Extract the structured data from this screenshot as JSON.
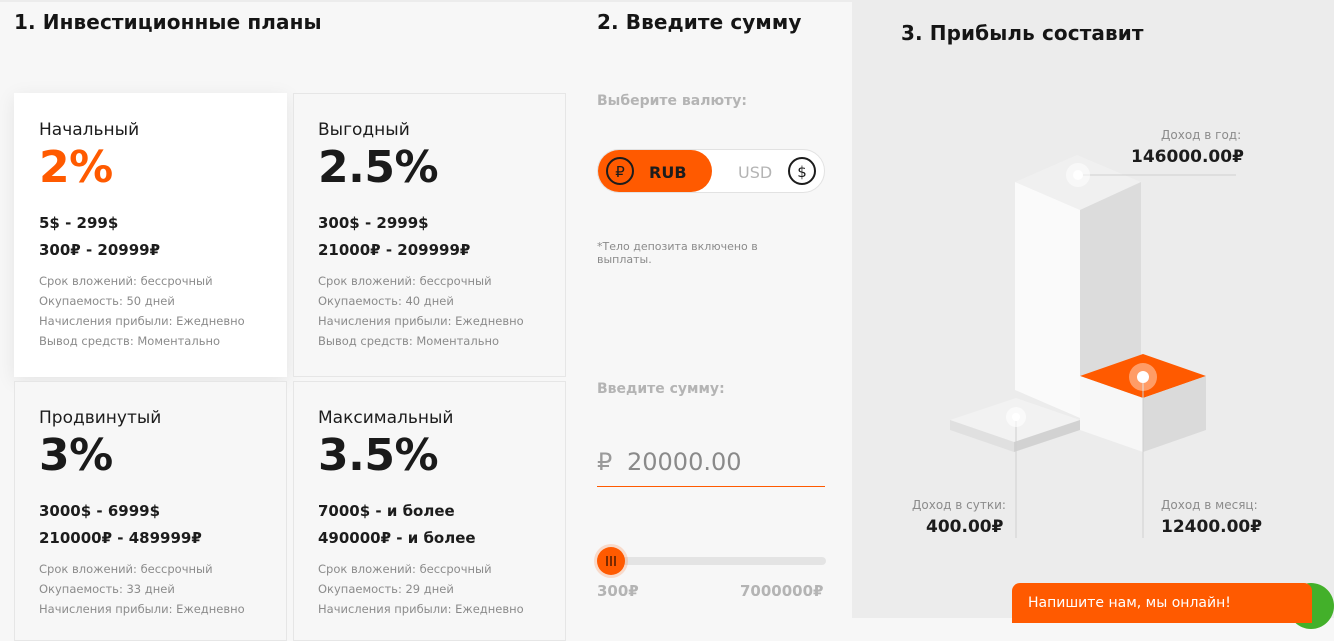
{
  "sections": {
    "plans_title": "1. Инвестиционные планы",
    "amount_title": "2. Введите сумму",
    "profit_title": "3. Прибыль составит"
  },
  "plans": [
    {
      "name": "Начальный",
      "percent": "2%",
      "usd_range": "5$ - 299$",
      "rub_range": "300₽ - 20999₽",
      "details": [
        "Срок вложений: бессрочный",
        "Окупаемость: 50 дней",
        "Начисления прибыли: Ежедневно",
        "Вывод средств: Моментально"
      ],
      "selected": true
    },
    {
      "name": "Выгодный",
      "percent": "2.5%",
      "usd_range": "300$ - 2999$",
      "rub_range": "21000₽ - 209999₽",
      "details": [
        "Срок вложений: бессрочный",
        "Окупаемость: 40 дней",
        "Начисления прибыли: Ежедневно",
        "Вывод средств: Моментально"
      ],
      "selected": false
    },
    {
      "name": "Продвинутый",
      "percent": "3%",
      "usd_range": "3000$ - 6999$",
      "rub_range": "210000₽ - 489999₽",
      "details": [
        "Срок вложений: бессрочный",
        "Окупаемость: 33 дней",
        "Начисления прибыли: Ежедневно"
      ],
      "selected": false
    },
    {
      "name": "Максимальный",
      "percent": "3.5%",
      "usd_range": "7000$ - и более",
      "rub_range": "490000₽ - и более",
      "details": [
        "Срок вложений: бессрочный",
        "Окупаемость: 29 дней",
        "Начисления прибыли: Ежедневно"
      ],
      "selected": false
    }
  ],
  "currency": {
    "label": "Выберите валюту:",
    "rub_label": "RUB",
    "rub_symbol": "₽",
    "usd_label": "USD",
    "usd_symbol": "$",
    "selected": "RUB"
  },
  "note": "*Тело депозита включено в выплаты.",
  "amount": {
    "label": "Введите сумму:",
    "currency_symbol": "₽",
    "value": "20000.00"
  },
  "slider": {
    "min_label": "300₽",
    "max_label": "7000000₽",
    "position": 0.0
  },
  "income": {
    "year_label": "Доход в год:",
    "year_value": "146000.00₽",
    "day_label": "Доход в сутки:",
    "day_value": "400.00₽",
    "month_label": "Доход в месяц:",
    "month_value": "12400.00₽"
  },
  "chat": {
    "label": "Напишите нам, мы онлайн!"
  },
  "colors": {
    "accent": "#ff5a00",
    "chat_online": "#43b02a"
  },
  "icons": [
    "ruble-coin-icon",
    "dollar-coin-icon",
    "slider-grip-icon"
  ]
}
